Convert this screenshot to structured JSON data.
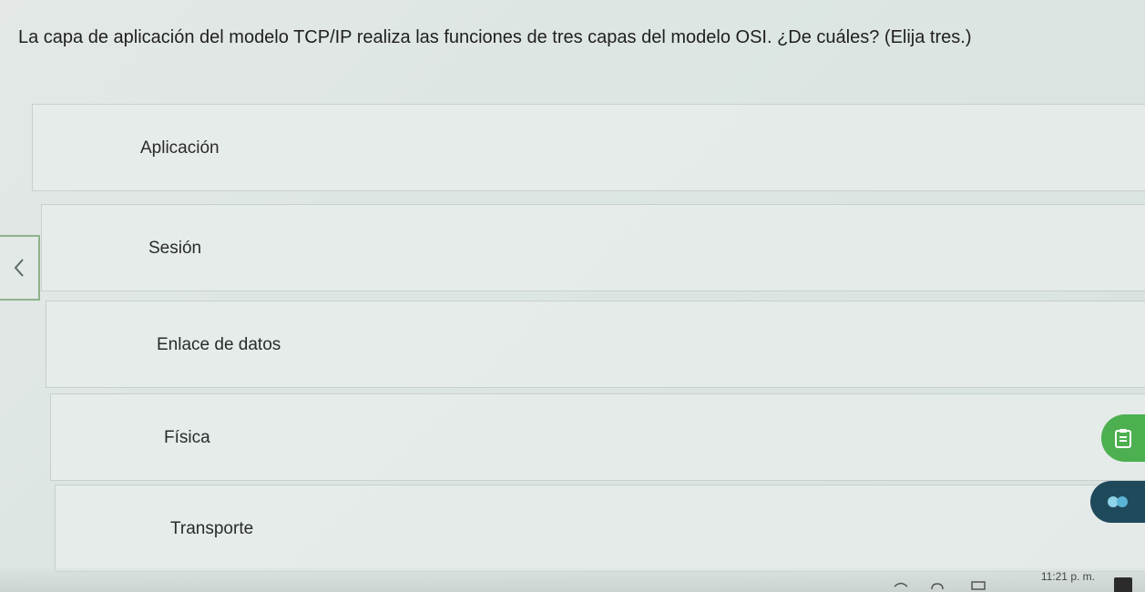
{
  "question": {
    "text": "La capa de aplicación del modelo TCP/IP realiza las funciones de tres capas del modelo OSI. ¿De cuáles? (Elija tres.)"
  },
  "options": [
    {
      "label": "Aplicación"
    },
    {
      "label": "Sesión"
    },
    {
      "label": "Enlace de datos"
    },
    {
      "label": "Física"
    },
    {
      "label": "Transporte"
    }
  ],
  "navigation": {
    "back_icon": "chevron-left-icon"
  },
  "floating_buttons": {
    "notes_icon": "clipboard-icon",
    "app_icon": "app-logo-icon"
  },
  "taskbar": {
    "clock": "11:21 p. m."
  },
  "colors": {
    "accent_green": "#4caf50",
    "back_border": "#8fb28a",
    "app_button": "#1f4a5c"
  }
}
